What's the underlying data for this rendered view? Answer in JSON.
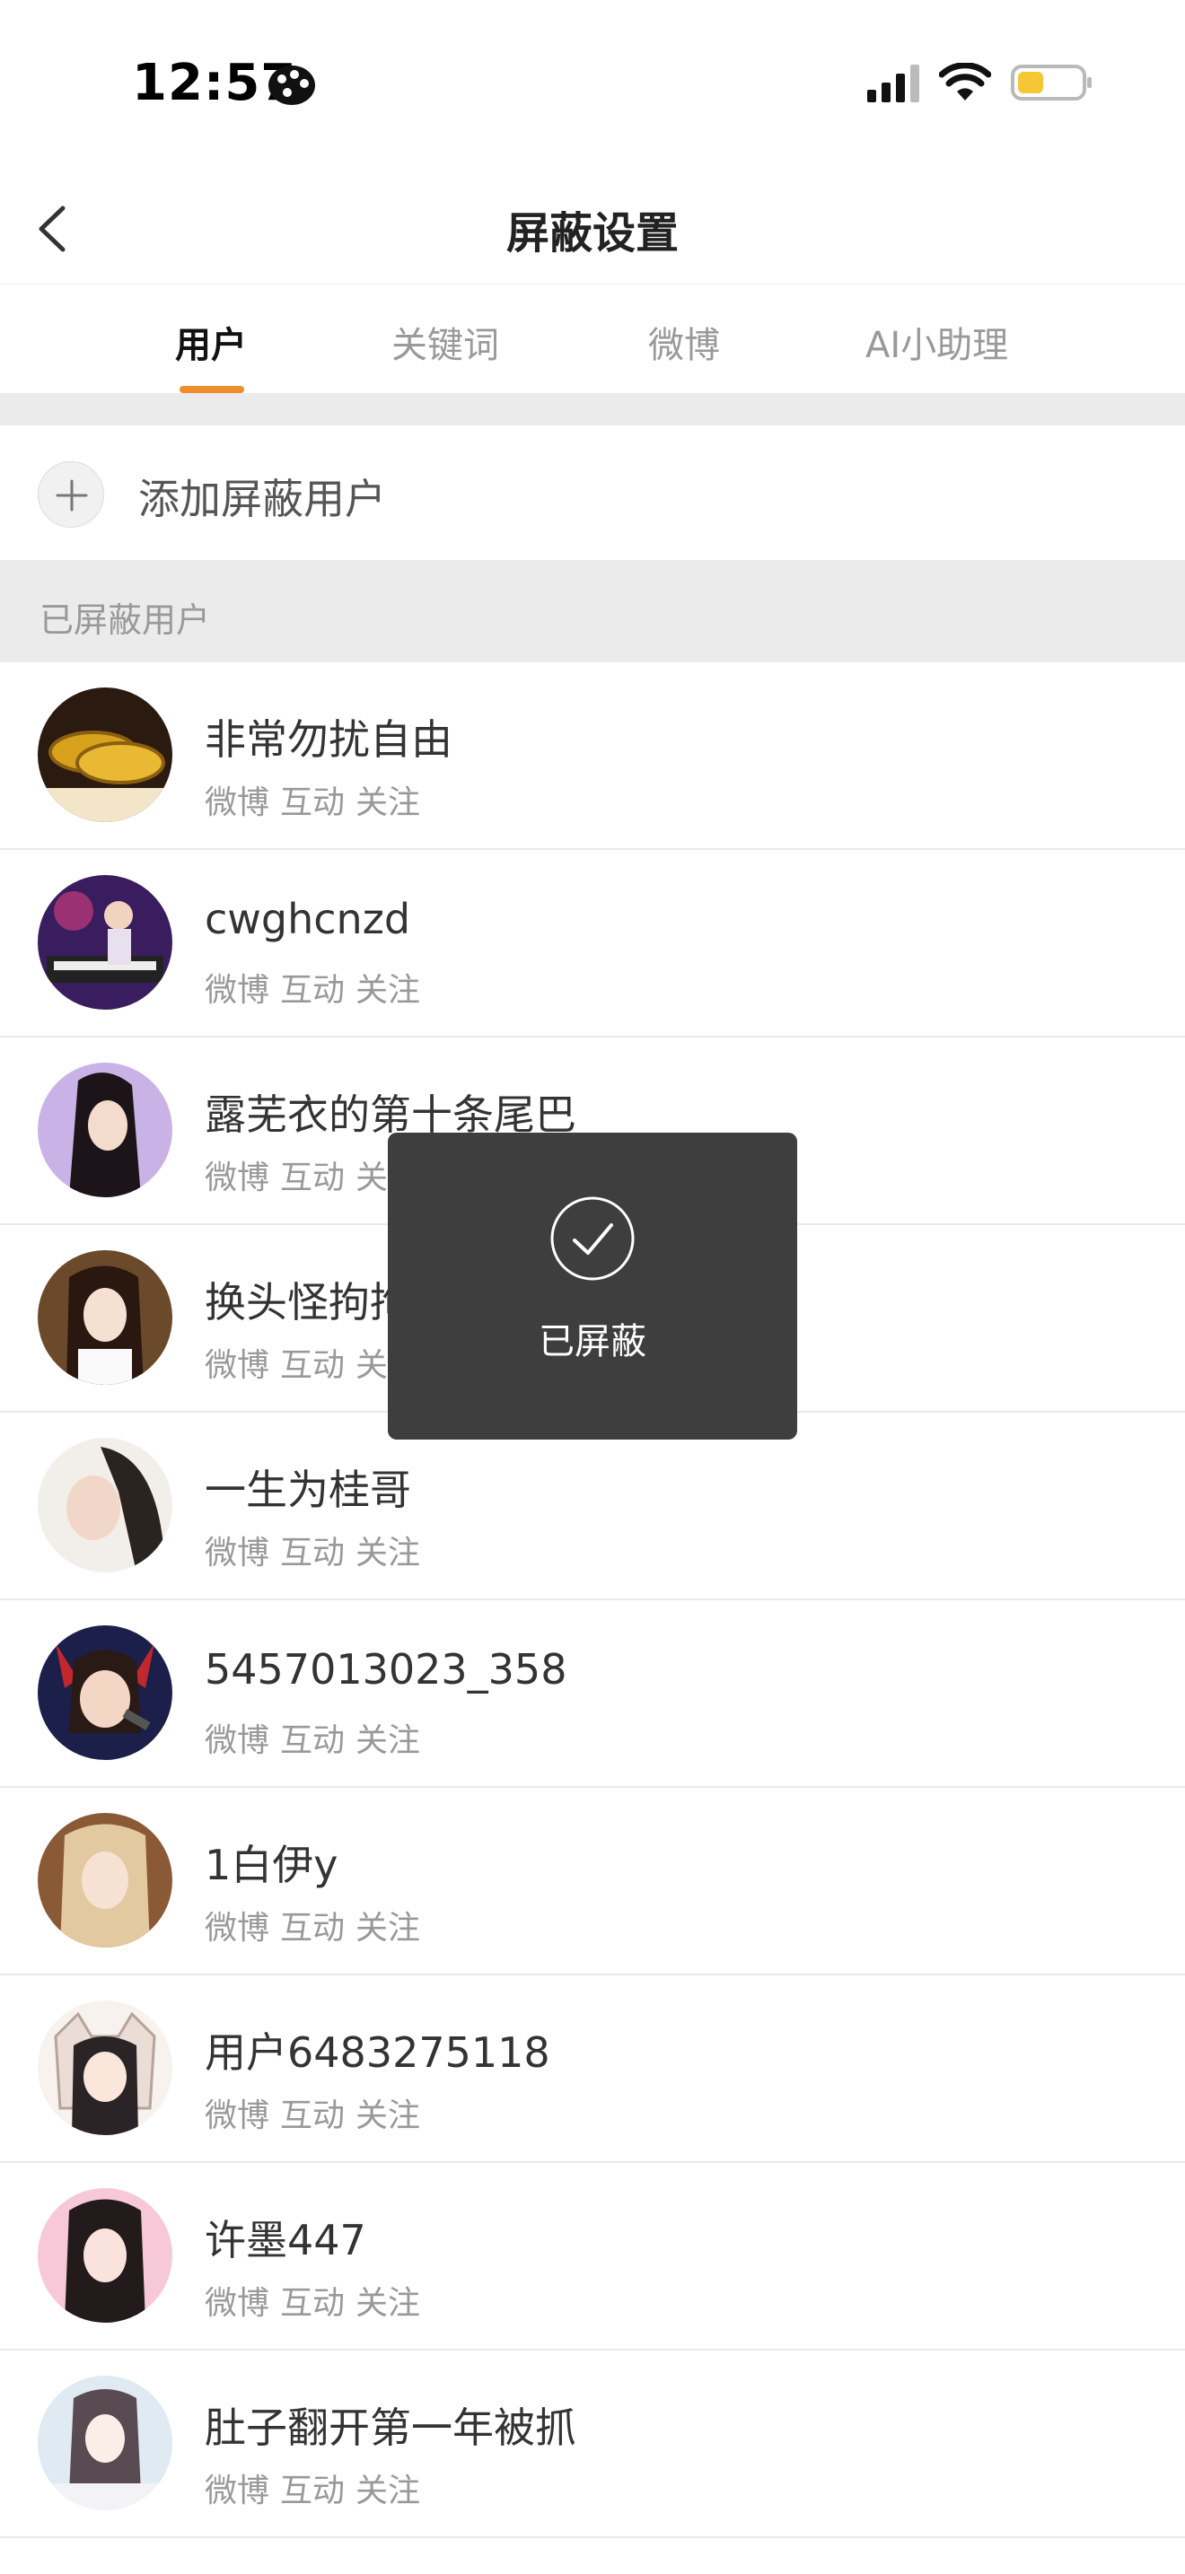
{
  "status_bar": {
    "time": "12:57"
  },
  "nav": {
    "title": "屏蔽设置"
  },
  "tabs": [
    {
      "label": "用户",
      "active": true
    },
    {
      "label": "关键词",
      "active": false
    },
    {
      "label": "微博",
      "active": false
    },
    {
      "label": "AI小助理",
      "active": false
    }
  ],
  "add_user": {
    "label": "添加屏蔽用户"
  },
  "section": {
    "label": "已屏蔽用户"
  },
  "actions": {
    "weibo": "微博",
    "interact": "互动",
    "follow": "关注"
  },
  "users": [
    {
      "name": "非常勿扰自由"
    },
    {
      "name": "cwghcnzd"
    },
    {
      "name": "露芜衣的第十条尾巴"
    },
    {
      "name": "换头怪拘拘"
    },
    {
      "name": "一生为桂哥"
    },
    {
      "name": "5457013023_358"
    },
    {
      "name": "1白伊y"
    },
    {
      "name": "用户6483275118"
    },
    {
      "name": "许墨447"
    },
    {
      "name": "肚子翻开第一年被抓"
    }
  ],
  "toast": {
    "text": "已屏蔽"
  },
  "colors": {
    "accent": "#f08c29",
    "toast_bg": "#3e3e3e",
    "battery": "#f6c634"
  }
}
